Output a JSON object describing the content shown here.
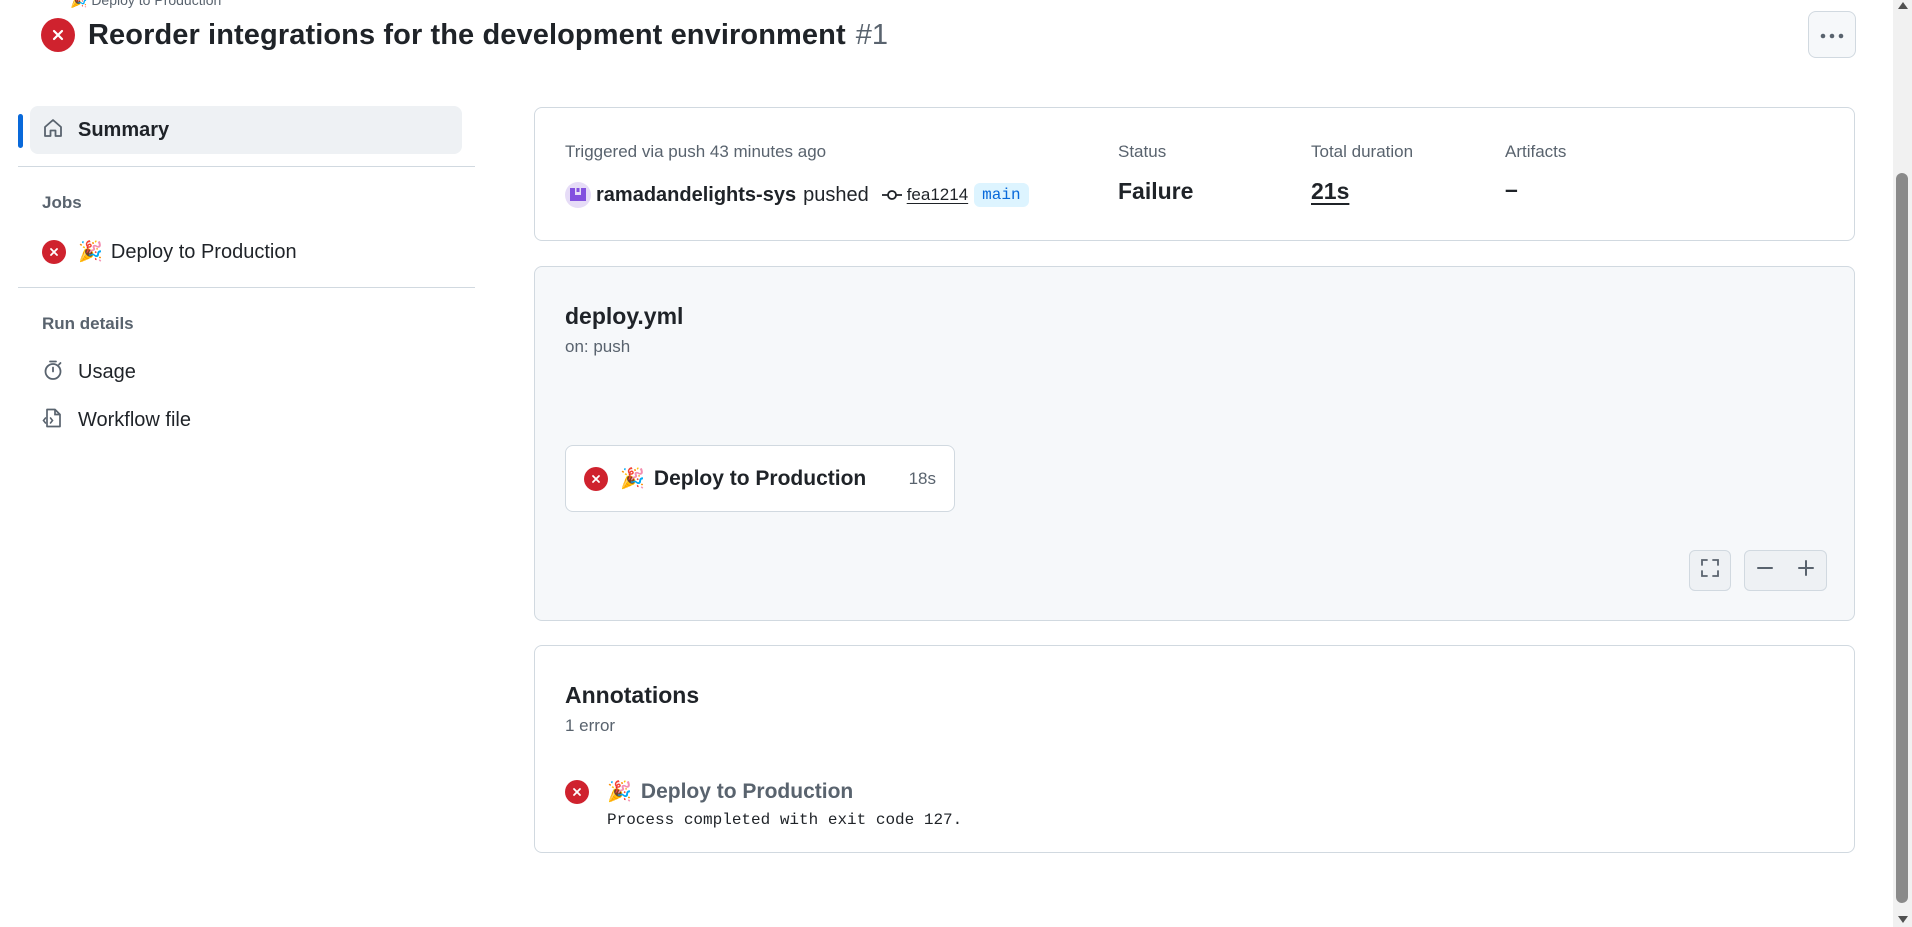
{
  "header": {
    "breadcrumb_hint": "🎉 Deploy to Production",
    "title": "Reorder integrations for the development environment",
    "run_number": "#1",
    "status_icon": "x-circle-fill-icon",
    "more_icon": "kebab-horizontal-icon"
  },
  "sidebar": {
    "summary_label": "Summary",
    "jobs_heading": "Jobs",
    "jobs": [
      {
        "emoji": "🎉",
        "label": "Deploy to Production",
        "status": "failure"
      }
    ],
    "run_details_heading": "Run details",
    "run_details": [
      {
        "icon": "stopwatch-icon",
        "label": "Usage"
      },
      {
        "icon": "file-code-icon",
        "label": "Workflow file"
      }
    ]
  },
  "trigger": {
    "triggered_text": "Triggered via push 43 minutes ago",
    "actor": "ramadandelights-sys",
    "action": "pushed",
    "commit": "fea1214",
    "branch": "main",
    "status_label": "Status",
    "status_value": "Failure",
    "duration_label": "Total duration",
    "duration_value": "21s",
    "artifacts_label": "Artifacts",
    "artifacts_value": "–"
  },
  "workflow": {
    "file": "deploy.yml",
    "trigger": "on: push",
    "job": {
      "emoji": "🎉",
      "name": "Deploy to Production",
      "duration": "18s"
    }
  },
  "annotations": {
    "title": "Annotations",
    "count": "1 error",
    "items": [
      {
        "emoji": "🎉",
        "job": "Deploy to Production",
        "message": "Process completed with exit code 127."
      }
    ]
  },
  "colors": {
    "failure": "#cf222e",
    "accent": "#0969da",
    "muted_text": "#59636e",
    "border": "#d1d9e0"
  }
}
